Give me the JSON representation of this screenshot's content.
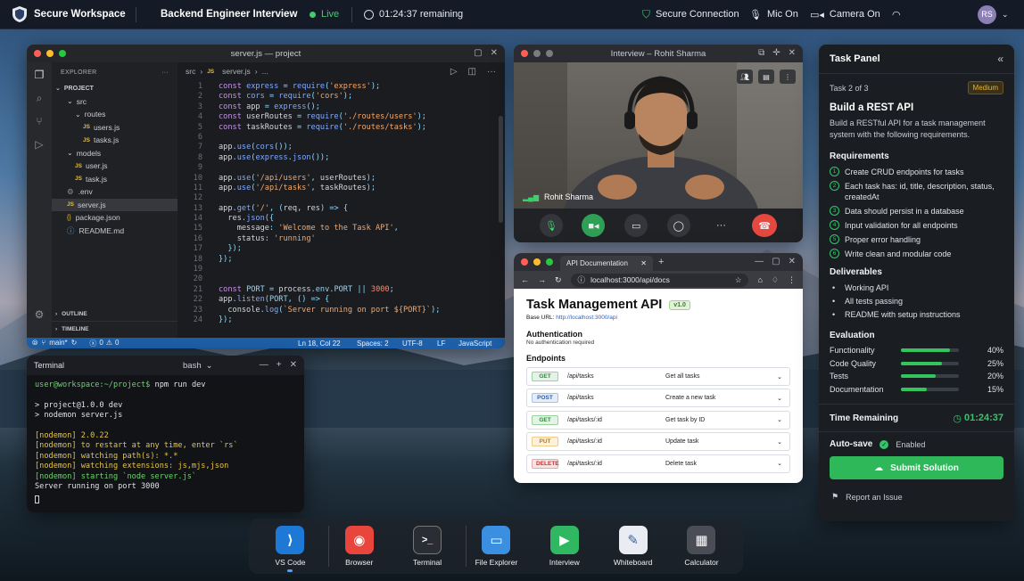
{
  "topbar": {
    "app_name": "Secure Workspace",
    "session_title": "Backend Engineer Interview",
    "live_label": "Live",
    "time_remaining": "01:24:37 remaining",
    "secure_connection": "Secure Connection",
    "mic": "Mic On",
    "camera": "Camera On",
    "user_initials": "RS"
  },
  "vscode": {
    "title": "server.js — project",
    "explorer_label": "EXPLORER",
    "project_label": "PROJECT",
    "tree": [
      {
        "label": "src",
        "indent": 1,
        "type": "folder"
      },
      {
        "label": "routes",
        "indent": 2,
        "type": "folder"
      },
      {
        "label": "users.js",
        "indent": 3,
        "type": "js"
      },
      {
        "label": "tasks.js",
        "indent": 3,
        "type": "js"
      },
      {
        "label": "models",
        "indent": 1,
        "type": "folder"
      },
      {
        "label": "user.js",
        "indent": 2,
        "type": "js"
      },
      {
        "label": "task.js",
        "indent": 2,
        "type": "js"
      },
      {
        "label": ".env",
        "indent": 1,
        "type": "gear"
      },
      {
        "label": "server.js",
        "indent": 1,
        "type": "js",
        "selected": true
      },
      {
        "label": "package.json",
        "indent": 1,
        "type": "json"
      },
      {
        "label": "README.md",
        "indent": 1,
        "type": "info"
      }
    ],
    "outline_label": "OUTLINE",
    "timeline_label": "TIMELINE",
    "breadcrumb": [
      "src",
      "server.js",
      "..."
    ],
    "status": {
      "branch": "main*",
      "problems": "0",
      "warnings": "0",
      "position": "Ln 18, Col 22",
      "spaces": "Spaces: 2",
      "encoding": "UTF-8",
      "eol": "LF",
      "language": "JavaScript"
    },
    "code": [
      "const express = require('express');",
      "const cors = require('cors');",
      "const app = express();",
      "const userRoutes = require('./routes/users');",
      "const taskRoutes = require('./routes/tasks');",
      "",
      "app.use(cors());",
      "app.use(express.json());",
      "",
      "app.use('/api/users', userRoutes);",
      "app.use('/api/tasks', taskRoutes);",
      "",
      "app.get('/', (req, res) => {",
      "  res.json({",
      "    message: 'Welcome to the Task API',",
      "    status: 'running'",
      "  });",
      "});",
      "",
      "",
      "const PORT = process.env.PORT || 3000;",
      "app.listen(PORT, () => {",
      "  console.log(`Server running on port ${PORT}`);",
      "});"
    ]
  },
  "terminal": {
    "title": "Terminal",
    "shell": "bash",
    "prompt": "user@workspace:~/project$",
    "command": "npm run dev",
    "lines": [
      {
        "text": "> project@1.0.0 dev",
        "color": "plain"
      },
      {
        "text": "> nodemon server.js",
        "color": "plain"
      },
      {
        "text": "",
        "color": "plain"
      },
      {
        "text": "[nodemon] 2.0.22",
        "color": "yellow"
      },
      {
        "text": "[nodemon] to restart at any time, enter `rs`",
        "color": "yellow"
      },
      {
        "text": "[nodemon] watching path(s): *.*",
        "color": "yellow"
      },
      {
        "text": "[nodemon] watching extensions: js,mjs,json",
        "color": "yellow"
      },
      {
        "text": "[nodemon] starting `node server.js`",
        "color": "green"
      },
      {
        "text": "Server running on port 3000",
        "color": "plain"
      }
    ]
  },
  "video": {
    "title": "Interview – Rohit Sharma",
    "participant": "Rohit Sharma"
  },
  "browser": {
    "tab_title": "API Documentation",
    "url": "localhost:3000/api/docs",
    "page_title": "Task Management API",
    "version": "v1.0",
    "base_url_label": "Base URL:",
    "base_url": "http://localhost:3000/api",
    "auth_heading": "Authentication",
    "auth_text": "No authentication required",
    "endpoints_heading": "Endpoints",
    "endpoints": [
      {
        "method": "GET",
        "path": "/api/tasks",
        "desc": "Get all tasks"
      },
      {
        "method": "POST",
        "path": "/api/tasks",
        "desc": "Create a new task"
      },
      {
        "method": "GET",
        "path": "/api/tasks/:id",
        "desc": "Get task by ID"
      },
      {
        "method": "PUT",
        "path": "/api/tasks/:id",
        "desc": "Update task"
      },
      {
        "method": "DELETE",
        "path": "/api/tasks/:id",
        "desc": "Delete task"
      }
    ]
  },
  "task_panel": {
    "title": "Task Panel",
    "task_counter": "Task 2 of 3",
    "difficulty": "Medium",
    "task_title": "Build a REST API",
    "task_desc": "Build a RESTful API for a task management system with the following requirements.",
    "requirements_heading": "Requirements",
    "requirements": [
      "Create CRUD endpoints for tasks",
      "Each task has: id, title, description, status, createdAt",
      "Data should persist in a database",
      "Input validation for all endpoints",
      "Proper error handling",
      "Write clean and modular code"
    ],
    "deliverables_heading": "Deliverables",
    "deliverables": [
      "Working API",
      "All tests passing",
      "README with setup instructions"
    ],
    "evaluation_heading": "Evaluation",
    "evaluation": [
      {
        "label": "Functionality",
        "percent": "40%",
        "fill": 0.85
      },
      {
        "label": "Code Quality",
        "percent": "25%",
        "fill": 0.7
      },
      {
        "label": "Tests",
        "percent": "20%",
        "fill": 0.6
      },
      {
        "label": "Documentation",
        "percent": "15%",
        "fill": 0.45
      }
    ],
    "time_heading": "Time Remaining",
    "time_value": "01:24:37",
    "autosave_label": "Auto-save",
    "autosave_state": "Enabled",
    "submit_label": "Submit Solution",
    "report_label": "Report an Issue"
  },
  "dock": [
    {
      "label": "VS Code",
      "icon": "vscode-icon",
      "color": "#1e78d6",
      "active": true
    },
    {
      "label": "Browser",
      "icon": "chrome-icon",
      "color": "#e8453c"
    },
    {
      "label": "Terminal",
      "icon": "terminal-icon",
      "color": "#2a2d33"
    },
    {
      "label": "File Explorer",
      "icon": "folder-icon",
      "color": "#3b8fe0"
    },
    {
      "label": "Interview",
      "icon": "video-icon",
      "color": "#2fb861"
    },
    {
      "label": "Whiteboard",
      "icon": "whiteboard-icon",
      "color": "#e9edf3"
    },
    {
      "label": "Calculator",
      "icon": "calculator-icon",
      "color": "#4a4d55"
    }
  ],
  "colors": {
    "accent_green": "#2fb85a",
    "live_green": "#3ecf6a",
    "statusbar_blue": "#1d5fa8",
    "medium_badge": "#c99a1e"
  }
}
